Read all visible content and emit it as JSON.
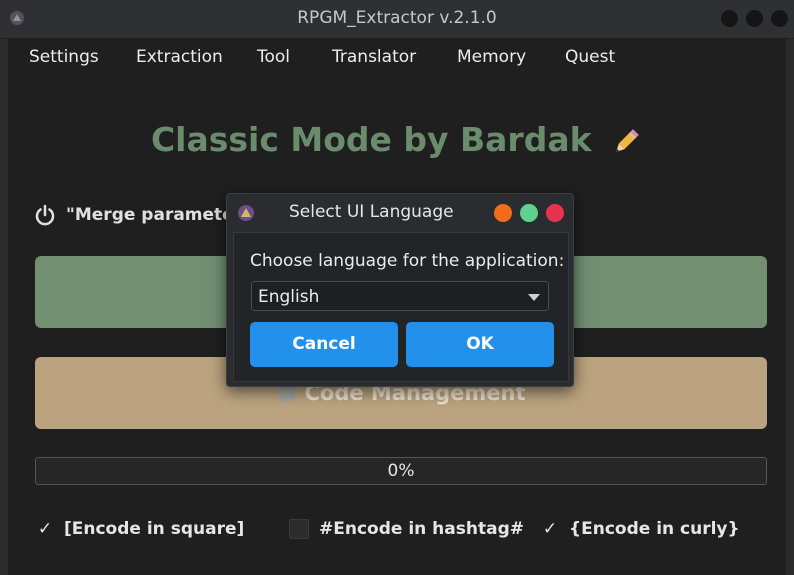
{
  "window": {
    "title": "RPGM_Extractor v.2.1.0"
  },
  "menu": [
    "Settings",
    "Extraction",
    "Tool",
    "Translator",
    "Memory",
    "Quest"
  ],
  "heading": "Classic Mode by Bardak",
  "merge_label": "\"Merge parameter",
  "code_management_label": "Code Management",
  "progress": {
    "text": "0%",
    "value": 0
  },
  "checkboxes": [
    {
      "label": "[Encode in square]",
      "checked": true
    },
    {
      "label": "#Encode in hashtag#",
      "checked": false
    },
    {
      "label": "{Encode in curly}",
      "checked": true
    }
  ],
  "dialog": {
    "title": "Select UI Language",
    "prompt": "Choose language for the application:",
    "selected_language": "English",
    "cancel_label": "Cancel",
    "ok_label": "OK"
  },
  "colors": {
    "heading": "#6b8b6d",
    "green_button": "#728f72",
    "tan_button": "#bba37f",
    "dialog_button": "#2391ec",
    "dot_orange": "#f26c1a",
    "dot_green": "#5fd38d",
    "dot_red": "#e8334f"
  },
  "icons": {
    "app": "app-logo-icon",
    "pencil": "pencil-icon",
    "power": "power-icon",
    "gear": "gear-icon",
    "dropdown": "chevron-down-icon"
  }
}
